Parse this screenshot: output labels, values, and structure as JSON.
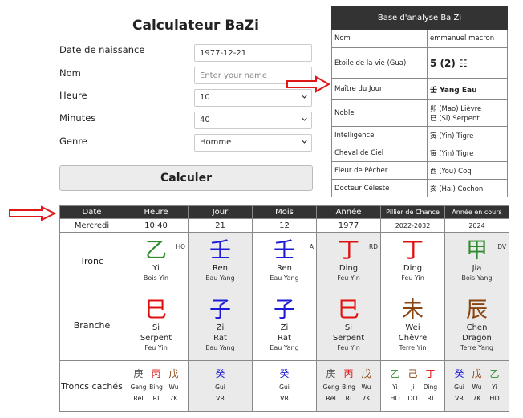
{
  "form": {
    "title": "Calculateur BaZi",
    "labels": {
      "birth_date": "Date de naissance",
      "name": "Nom",
      "hour": "Heure",
      "minutes": "Minutes",
      "gender": "Genre"
    },
    "birth_date_value": "1977-12-21",
    "name_placeholder": "Enter your name",
    "hour_value": "10",
    "minutes_value": "40",
    "gender_value": "Homme",
    "submit_label": "Calculer"
  },
  "analysis": {
    "title": "Base d'analyse Ba Zi",
    "rows": [
      {
        "label": "Nom",
        "value": "emmanuel macron"
      },
      {
        "label": "Etoile de la vie (Gua)",
        "value": "5 (2) ☷"
      },
      {
        "label": "Maître du Jour",
        "value": "壬 Yang Eau"
      },
      {
        "label": "Noble",
        "value": "卯 (Mao) Lièvre",
        "value2": "巳 (Si) Serpent"
      },
      {
        "label": "Intelligence",
        "value": "寅 (Yin) Tigre"
      },
      {
        "label": "Cheval de Ciel",
        "value": "寅 (Yin) Tigre"
      },
      {
        "label": "Fleur de Pêcher",
        "value": "酉 (You) Coq"
      },
      {
        "label": "Docteur Céleste",
        "value": "亥 (Hai) Cochon"
      }
    ]
  },
  "chart": {
    "headers": [
      "Date",
      "Heure",
      "Jour",
      "Mois",
      "Année",
      "Pillier de Chance",
      "Année en cours"
    ],
    "sub": [
      "Mercredi",
      "10:40",
      "21",
      "12",
      "1977",
      "2022-2032",
      "2024"
    ],
    "row_labels": {
      "stem": "Tronc",
      "branch": "Branche",
      "hidden": "Troncs cachés"
    },
    "stems": [
      {
        "char": "乙",
        "name": "Yi",
        "elem": "Bois Yin",
        "tag": "HO",
        "color": "#2e8b2e"
      },
      {
        "char": "壬",
        "name": "Ren",
        "elem": "Eau Yang",
        "tag": "",
        "color": "#1c1cd6"
      },
      {
        "char": "壬",
        "name": "Ren",
        "elem": "Eau Yang",
        "tag": "A",
        "color": "#1c1cd6"
      },
      {
        "char": "丁",
        "name": "Ding",
        "elem": "Feu Yin",
        "tag": "RD",
        "color": "#e01010"
      },
      {
        "char": "丁",
        "name": "Ding",
        "elem": "Feu Yin",
        "tag": "",
        "color": "#e01010"
      },
      {
        "char": "甲",
        "name": "Jia",
        "elem": "Bois Yang",
        "tag": "DV",
        "color": "#2e8b2e"
      }
    ],
    "branches": [
      {
        "char": "巳",
        "name": "Si",
        "animal": "Serpent",
        "elem": "Feu Yin",
        "color": "#e01010"
      },
      {
        "char": "子",
        "name": "Zi",
        "animal": "Rat",
        "elem": "Eau Yang",
        "color": "#1c1cd6"
      },
      {
        "char": "子",
        "name": "Zi",
        "animal": "Rat",
        "elem": "Eau Yang",
        "color": "#1c1cd6"
      },
      {
        "char": "巳",
        "name": "Si",
        "animal": "Serpent",
        "elem": "Feu Yin",
        "color": "#e01010"
      },
      {
        "char": "未",
        "name": "Wei",
        "animal": "Chèvre",
        "elem": "Terre Yin",
        "color": "#8b4513"
      },
      {
        "char": "辰",
        "name": "Chen",
        "animal": "Dragon",
        "elem": "Terre Yang",
        "color": "#8b4513"
      }
    ],
    "hidden": [
      [
        {
          "char": "庚",
          "name": "Geng",
          "rel": "ReI",
          "color": "#555"
        },
        {
          "char": "丙",
          "name": "Bing",
          "rel": "RI",
          "color": "#e01010"
        },
        {
          "char": "戊",
          "name": "Wu",
          "rel": "7K",
          "color": "#8b4513"
        }
      ],
      [
        {
          "char": "癸",
          "name": "Gui",
          "rel": "VR",
          "color": "#1c1cd6"
        }
      ],
      [
        {
          "char": "癸",
          "name": "Gui",
          "rel": "VR",
          "color": "#1c1cd6"
        }
      ],
      [
        {
          "char": "庚",
          "name": "Geng",
          "rel": "RеI",
          "color": "#555"
        },
        {
          "char": "丙",
          "name": "Bing",
          "rel": "RI",
          "color": "#e01010"
        },
        {
          "char": "戊",
          "name": "Wu",
          "rel": "7K",
          "color": "#8b4513"
        }
      ],
      [
        {
          "char": "乙",
          "name": "Yi",
          "rel": "HO",
          "color": "#2e8b2e"
        },
        {
          "char": "己",
          "name": "Ji",
          "rel": "DO",
          "color": "#8b4513"
        },
        {
          "char": "丁",
          "name": "Ding",
          "rel": "RI",
          "color": "#e01010"
        }
      ],
      [
        {
          "char": "癸",
          "name": "Gui",
          "rel": "VR",
          "color": "#1c1cd6"
        },
        {
          "char": "戊",
          "name": "Wu",
          "rel": "7K",
          "color": "#8b4513"
        },
        {
          "char": "乙",
          "name": "Yi",
          "rel": "HO",
          "color": "#2e8b2e"
        }
      ]
    ]
  }
}
